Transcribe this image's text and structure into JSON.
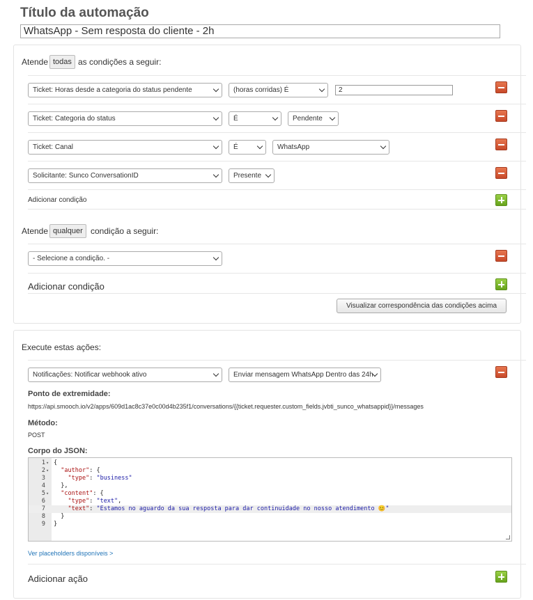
{
  "header": {
    "title": "Título da automação",
    "name_value": "WhatsApp - Sem resposta do cliente - 2h"
  },
  "conditions_all": {
    "prefix": "Atende",
    "chip": "todas",
    "suffix": "as condições a seguir:",
    "rows": [
      {
        "field": "Ticket: Horas desde a categoria do status pendente",
        "operator": "(horas corridas) É",
        "value": "2"
      },
      {
        "field": "Ticket: Categoria do status",
        "operator": "É",
        "value": "Pendente"
      },
      {
        "field": "Ticket: Canal",
        "operator": "É",
        "value": "WhatsApp"
      },
      {
        "field": "Solicitante: Sunco ConversationID",
        "operator": "Presente",
        "value": ""
      }
    ],
    "add_label": "Adicionar condição"
  },
  "conditions_any": {
    "prefix": "Atende",
    "chip": "qualquer",
    "suffix": "condição a seguir:",
    "select_placeholder": "- Selecione a condição. -",
    "add_label": "Adicionar condição",
    "preview_button": "Visualizar correspondência das condições acima"
  },
  "actions": {
    "heading": "Execute estas ações:",
    "action_field": "Notificações: Notificar webhook ativo",
    "action_value": "Enviar mensagem WhatsApp Dentro das 24h",
    "endpoint_label": "Ponto de extremidade:",
    "endpoint_value": "https://api.smooch.io/v2/apps/609d1ac8c37e0c00d4b235f1/conversations/{{ticket.requester.custom_fields.jvbti_sunco_whatsappid}}/messages",
    "method_label": "Método:",
    "method_value": "POST",
    "json_label": "Corpo do JSON:",
    "json_lines": [
      {
        "n": "1",
        "fold": "▾",
        "text": "{"
      },
      {
        "n": "2",
        "fold": "▾",
        "text": "  \"author\": {"
      },
      {
        "n": "3",
        "fold": "",
        "text": "    \"type\": \"business\""
      },
      {
        "n": "4",
        "fold": "",
        "text": "  },"
      },
      {
        "n": "5",
        "fold": "▾",
        "text": "  \"content\": {"
      },
      {
        "n": "6",
        "fold": "",
        "text": "    \"type\": \"text\","
      },
      {
        "n": "7",
        "fold": "",
        "text": "    \"text\": \"Estamos no aguardo da sua resposta para dar continuidade no nosso atendimento 😊\""
      },
      {
        "n": "8",
        "fold": "",
        "text": "  }"
      },
      {
        "n": "9",
        "fold": "",
        "text": "}"
      }
    ],
    "placeholders_link": "Ver placeholders disponíveis >",
    "add_action_label": "Adicionar ação"
  }
}
